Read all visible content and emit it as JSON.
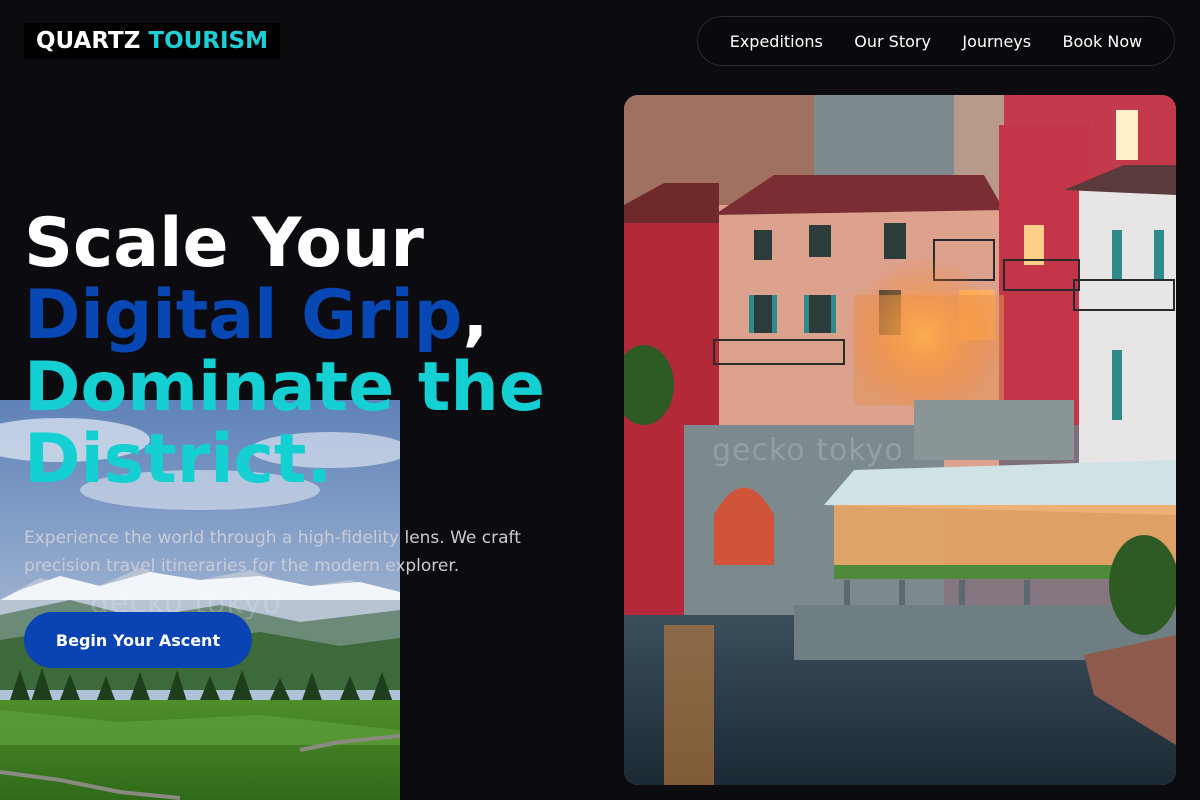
{
  "brand": {
    "word1": "QUARTZ",
    "word2": "TOURISM"
  },
  "nav": {
    "items": [
      {
        "label": "Expeditions"
      },
      {
        "label": "Our Story"
      },
      {
        "label": "Journeys"
      },
      {
        "label": "Book Now"
      }
    ]
  },
  "hero": {
    "line1": "Scale Your",
    "line2": "Digital Grip",
    "line2_punct": ",",
    "line3": "Dominate the",
    "line4": "District.",
    "lede": "Experience the world through a high-fidelity lens. We craft precision travel itineraries for the modern explorer.",
    "cta_label": "Begin Your Ascent"
  },
  "images": {
    "meadow_watermark": "gecko tokyo",
    "village_watermark": "gecko tokyo"
  },
  "colors": {
    "background": "#0c0b0f",
    "accent_teal": "#14d0d2",
    "accent_blue": "#0848b4",
    "button": "#0a44b4"
  }
}
